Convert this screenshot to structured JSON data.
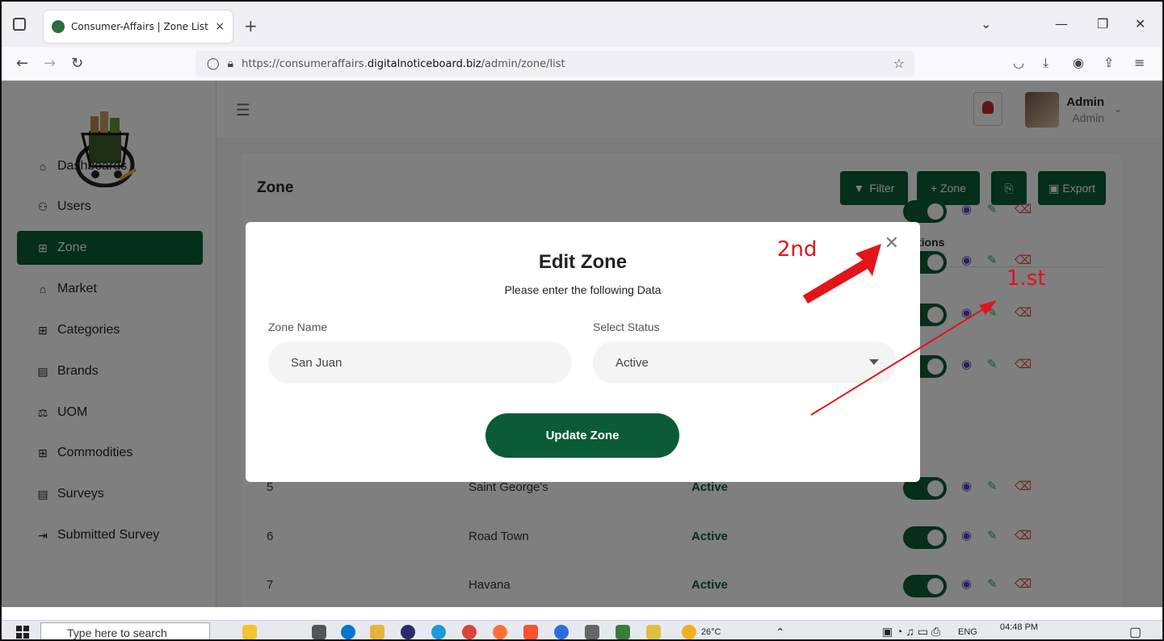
{
  "browser": {
    "tab_title": "Consumer-Affairs | Zone List",
    "tab_close": "×",
    "new_tab": "+",
    "url_prefix": "https://consumeraffairs.",
    "url_domain": "digitalnoticeboard.biz",
    "url_path": "/admin/zone/list"
  },
  "sidebar": {
    "items": [
      {
        "label": "Dashboards",
        "icon": "home-icon"
      },
      {
        "label": "Users",
        "icon": "users-icon"
      },
      {
        "label": "Zone",
        "icon": "grid-icon"
      },
      {
        "label": "Market",
        "icon": "store-icon"
      },
      {
        "label": "Categories",
        "icon": "grid-icon"
      },
      {
        "label": "Brands",
        "icon": "clipboard-icon"
      },
      {
        "label": "UOM",
        "icon": "scale-icon"
      },
      {
        "label": "Commodities",
        "icon": "grid-icon"
      },
      {
        "label": "Surveys",
        "icon": "form-icon"
      },
      {
        "label": "Submitted Survey",
        "icon": "file-arrow-icon"
      }
    ]
  },
  "header": {
    "user_name": "Admin",
    "user_role": "Admin",
    "notification_count": "0"
  },
  "card": {
    "title": "Zone",
    "filter_label": "Filter",
    "add_label": "+ Zone",
    "export_label": "Export",
    "actions_header": "tions"
  },
  "rows": [
    {
      "id": "5",
      "name": "Saint George's",
      "status": "Active"
    },
    {
      "id": "6",
      "name": "Road Town",
      "status": "Active"
    },
    {
      "id": "7",
      "name": "Havana",
      "status": "Active"
    }
  ],
  "modal": {
    "title": "Edit Zone",
    "subtitle": "Please enter the following Data",
    "zone_name_label": "Zone Name",
    "zone_name_value": "San Juan",
    "status_label": "Select Status",
    "status_value": "Active",
    "submit_label": "Update Zone"
  },
  "annotations": {
    "first": "1.st",
    "second": "2nd"
  },
  "taskbar": {
    "search_placeholder": "Type here to search",
    "temperature": "26°C",
    "language": "ENG",
    "time": "04:48 PM"
  },
  "colors": {
    "brand_green": "#0b5c36",
    "annotation_red": "#e2141a"
  }
}
